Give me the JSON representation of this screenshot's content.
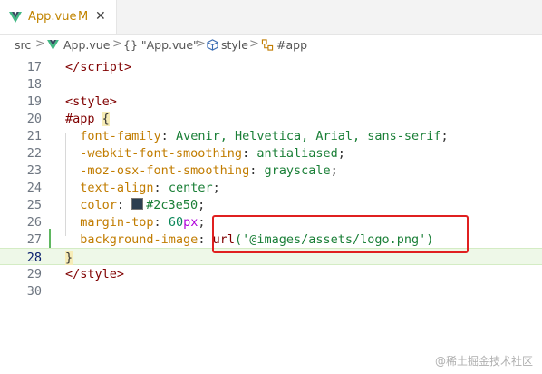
{
  "tab": {
    "title": "App.vue",
    "status": "M",
    "close": "✕"
  },
  "breadcrumb": {
    "items": [
      "src",
      "App.vue",
      "{} \"App.vue\"",
      "style",
      "#app"
    ],
    "sep": ">"
  },
  "editor": {
    "lines": [
      {
        "num": "17",
        "segments": [
          {
            "t": "</",
            "c": "punct"
          },
          {
            "t": "script",
            "c": "tag"
          },
          {
            "t": ">",
            "c": "punct"
          }
        ]
      },
      {
        "num": "18",
        "segments": []
      },
      {
        "num": "19",
        "segments": [
          {
            "t": "<",
            "c": "punct"
          },
          {
            "t": "style",
            "c": "tag"
          },
          {
            "t": ">",
            "c": "punct"
          }
        ]
      },
      {
        "num": "20",
        "segments": [
          {
            "t": "#app ",
            "c": "sel"
          },
          {
            "t": "{",
            "c": "brace"
          }
        ]
      },
      {
        "num": "21",
        "segments": [
          {
            "t": "  font-family",
            "c": "propname"
          },
          {
            "t": ": ",
            "c": ""
          },
          {
            "t": "Avenir, Helvetica, Arial, sans-serif",
            "c": "val"
          },
          {
            "t": ";",
            "c": ""
          }
        ]
      },
      {
        "num": "22",
        "segments": [
          {
            "t": "  -webkit-font-smoothing",
            "c": "propname"
          },
          {
            "t": ": ",
            "c": ""
          },
          {
            "t": "antialiased",
            "c": "val"
          },
          {
            "t": ";",
            "c": ""
          }
        ]
      },
      {
        "num": "23",
        "segments": [
          {
            "t": "  -moz-osx-font-smoothing",
            "c": "propname"
          },
          {
            "t": ": ",
            "c": ""
          },
          {
            "t": "grayscale",
            "c": "val"
          },
          {
            "t": ";",
            "c": ""
          }
        ]
      },
      {
        "num": "24",
        "segments": [
          {
            "t": "  text-align",
            "c": "propname"
          },
          {
            "t": ": ",
            "c": ""
          },
          {
            "t": "center",
            "c": "val"
          },
          {
            "t": ";",
            "c": ""
          }
        ]
      },
      {
        "num": "25",
        "segments": [
          {
            "t": "  color",
            "c": "propname"
          },
          {
            "t": ": ",
            "c": ""
          },
          {
            "t": "",
            "c": "colorbox"
          },
          {
            "t": "#2c3e50",
            "c": "val"
          },
          {
            "t": ";",
            "c": ""
          }
        ]
      },
      {
        "num": "26",
        "segments": [
          {
            "t": "  margin-top",
            "c": "propname"
          },
          {
            "t": ": ",
            "c": ""
          },
          {
            "t": "60",
            "c": "num"
          },
          {
            "t": "px",
            "c": "unit"
          },
          {
            "t": ";",
            "c": ""
          }
        ]
      },
      {
        "num": "27",
        "segments": [
          {
            "t": "  background-image",
            "c": "propname"
          },
          {
            "t": ": ",
            "c": ""
          },
          {
            "t": "url",
            "c": "tag"
          },
          {
            "t": "('@images/assets/logo.png')",
            "c": "val"
          }
        ]
      },
      {
        "num": "28",
        "segments": [
          {
            "t": "}",
            "c": "brace"
          }
        ]
      },
      {
        "num": "29",
        "segments": [
          {
            "t": "</",
            "c": "punct"
          },
          {
            "t": "style",
            "c": "tag"
          },
          {
            "t": ">",
            "c": "punct"
          }
        ]
      },
      {
        "num": "30",
        "segments": []
      }
    ],
    "active_line": "28",
    "swatch_color": "#2c3e50"
  },
  "watermark": "@稀土掘金技术社区"
}
